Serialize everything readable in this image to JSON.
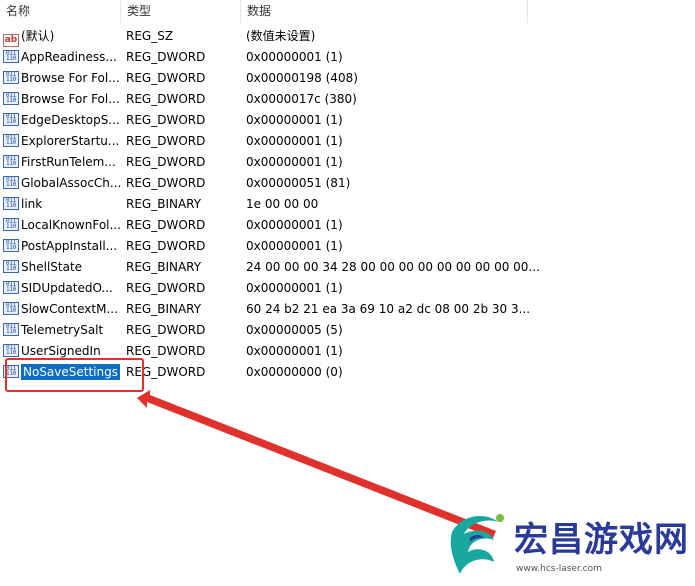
{
  "columns": {
    "name": "名称",
    "type": "类型",
    "data": "数据"
  },
  "rows": [
    {
      "icon": "string-value-icon",
      "name": "(默认)",
      "type": "REG_SZ",
      "data": "(数值未设置)"
    },
    {
      "icon": "binary-value-icon",
      "name": "AppReadiness...",
      "type": "REG_DWORD",
      "data": "0x00000001 (1)"
    },
    {
      "icon": "binary-value-icon",
      "name": "Browse For Fol...",
      "type": "REG_DWORD",
      "data": "0x00000198 (408)"
    },
    {
      "icon": "binary-value-icon",
      "name": "Browse For Fol...",
      "type": "REG_DWORD",
      "data": "0x0000017c (380)"
    },
    {
      "icon": "binary-value-icon",
      "name": "EdgeDesktopS...",
      "type": "REG_DWORD",
      "data": "0x00000001 (1)"
    },
    {
      "icon": "binary-value-icon",
      "name": "ExplorerStartu...",
      "type": "REG_DWORD",
      "data": "0x00000001 (1)"
    },
    {
      "icon": "binary-value-icon",
      "name": "FirstRunTelem...",
      "type": "REG_DWORD",
      "data": "0x00000001 (1)"
    },
    {
      "icon": "binary-value-icon",
      "name": "GlobalAssocCh...",
      "type": "REG_DWORD",
      "data": "0x00000051 (81)"
    },
    {
      "icon": "binary-value-icon",
      "name": "link",
      "type": "REG_BINARY",
      "data": "1e 00 00 00"
    },
    {
      "icon": "binary-value-icon",
      "name": "LocalKnownFol...",
      "type": "REG_DWORD",
      "data": "0x00000001 (1)"
    },
    {
      "icon": "binary-value-icon",
      "name": "PostAppInstall...",
      "type": "REG_DWORD",
      "data": "0x00000001 (1)"
    },
    {
      "icon": "binary-value-icon",
      "name": "ShellState",
      "type": "REG_BINARY",
      "data": "24 00 00 00 34 28 00 00 00 00 00 00 00 00 00..."
    },
    {
      "icon": "binary-value-icon",
      "name": "SIDUpdatedO...",
      "type": "REG_DWORD",
      "data": "0x00000001 (1)"
    },
    {
      "icon": "binary-value-icon",
      "name": "SlowContextM...",
      "type": "REG_BINARY",
      "data": "60 24 b2 21 ea 3a 69 10 a2 dc 08 00 2b 30 3..."
    },
    {
      "icon": "binary-value-icon",
      "name": "TelemetrySalt",
      "type": "REG_DWORD",
      "data": "0x00000005 (5)"
    },
    {
      "icon": "binary-value-icon",
      "name": "UserSignedIn",
      "type": "REG_DWORD",
      "data": "0x00000001 (1)"
    },
    {
      "icon": "binary-value-icon",
      "name": "NoSaveSettings",
      "type": "REG_DWORD",
      "data": "0x00000000 (0)",
      "selected": true
    }
  ],
  "annotation": {
    "color": "#e0322c"
  },
  "watermark": {
    "text": "宏昌游戏网",
    "url": "www.hcs-laser.com"
  },
  "colors": {
    "selection": "#0b6ec7",
    "watermark": "#2a3a99"
  }
}
